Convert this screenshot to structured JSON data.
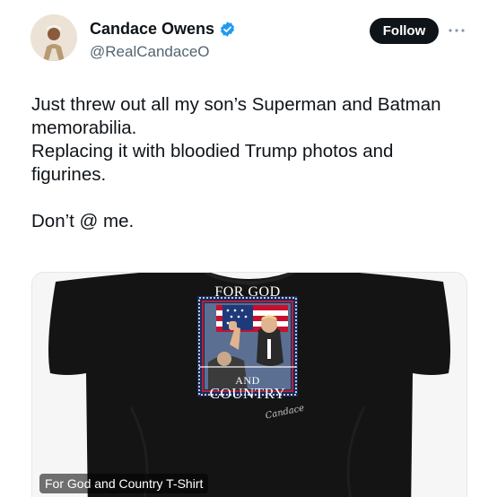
{
  "author": {
    "name": "Candace Owens",
    "handle": "@RealCandaceO",
    "verified": true
  },
  "actions": {
    "follow_label": "Follow",
    "more_icon": "more-dots-icon"
  },
  "tweet": {
    "lines": [
      "Just threw out all my son’s Superman and Batman",
      "memorabilia.",
      "Replacing it with bloodied Trump photos and",
      "figurines.",
      "",
      "Don’t @ me."
    ]
  },
  "media": {
    "caption": "For God and Country T-Shirt",
    "print": {
      "top_text": "FOR GOD",
      "mid_text": "AND",
      "bottom_text": "COUNTRY",
      "signature": "Candace"
    }
  },
  "colors": {
    "follow_bg": "#0f1419",
    "verified": "#1d9bf0",
    "handle": "#536471",
    "shirt": "#141414"
  }
}
